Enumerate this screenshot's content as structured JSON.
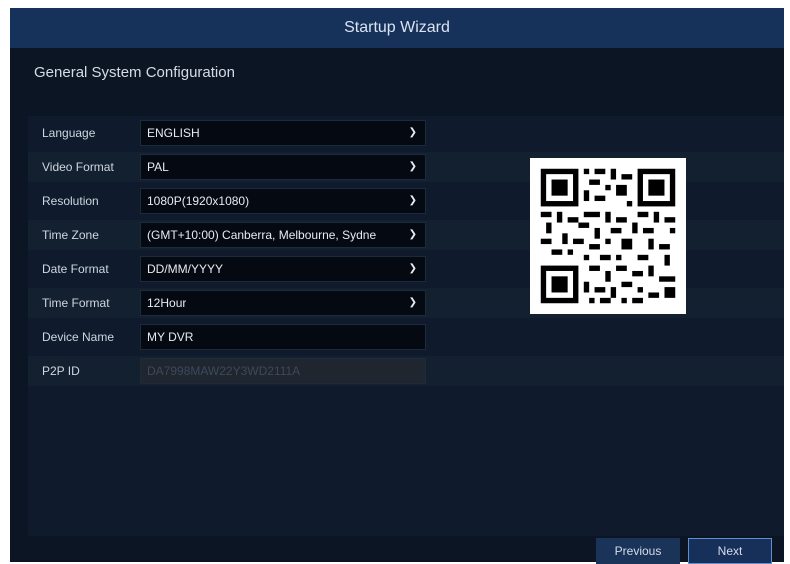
{
  "window": {
    "title": "Startup Wizard"
  },
  "section": {
    "title": "General System Configuration"
  },
  "form": {
    "rows": [
      {
        "label": "Language",
        "value": "ENGLISH",
        "type": "select"
      },
      {
        "label": "Video Format",
        "value": "PAL",
        "type": "select"
      },
      {
        "label": "Resolution",
        "value": "1080P(1920x1080)",
        "type": "select"
      },
      {
        "label": "Time Zone",
        "value": "(GMT+10:00) Canberra, Melbourne, Sydne",
        "type": "select"
      },
      {
        "label": "Date Format",
        "value": "DD/MM/YYYY",
        "type": "select"
      },
      {
        "label": "Time Format",
        "value": "12Hour",
        "type": "select"
      },
      {
        "label": "Device Name",
        "value": "MY DVR",
        "type": "text"
      },
      {
        "label": "P2P ID",
        "value": "DA7998MAW22Y3WD2111A",
        "type": "readonly"
      }
    ]
  },
  "buttons": {
    "previous": "Previous",
    "next": "Next"
  },
  "icons": {
    "dropdown": "chevron-down-icon",
    "qr": "qr-code"
  },
  "colors": {
    "accent": "#17325a",
    "background": "#0c1524"
  }
}
